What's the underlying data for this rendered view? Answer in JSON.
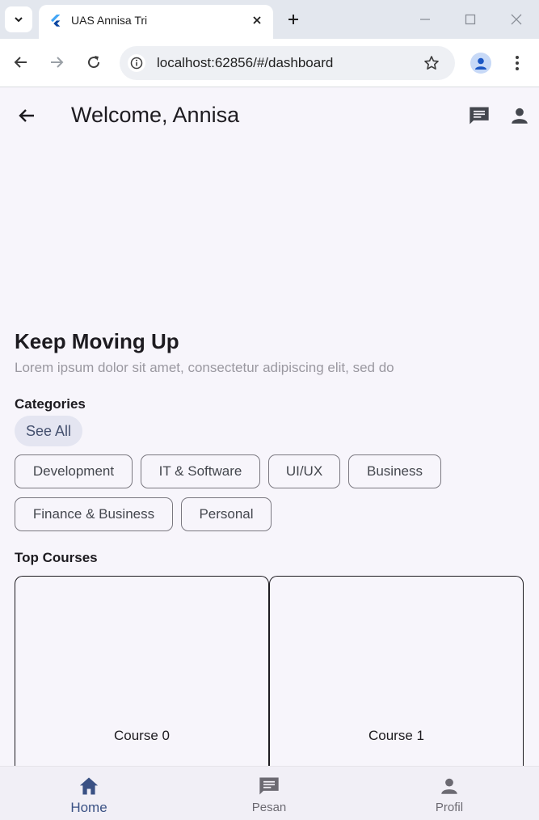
{
  "browser": {
    "tab_title": "UAS Annisa Tri",
    "url": "localhost:62856/#/dashboard"
  },
  "appbar": {
    "title": "Welcome, Annisa"
  },
  "hero": {
    "title": "Keep Moving Up",
    "subtitle": "Lorem ipsum dolor sit amet, consectetur adipiscing elit, sed do"
  },
  "categories": {
    "heading": "Categories",
    "see_all": "See All",
    "chips": [
      "Development",
      "IT & Software",
      "UI/UX",
      "Business",
      "Finance & Business",
      "Personal"
    ]
  },
  "courses": {
    "heading": "Top Courses",
    "items": [
      "Course 0",
      "Course 1"
    ]
  },
  "bottom_nav": {
    "items": [
      "Home",
      "Pesan",
      "Profil"
    ],
    "active": "Home"
  },
  "colors": {
    "accent": "#3a5184",
    "background": "#f7f5fb",
    "chip_border": "#7a7880"
  }
}
